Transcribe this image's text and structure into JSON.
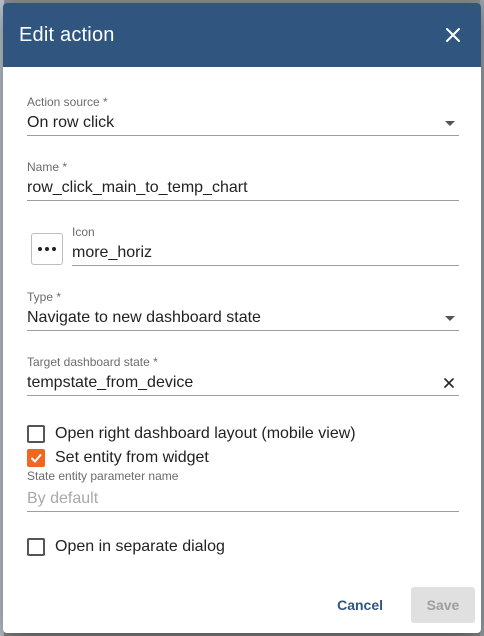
{
  "dialog": {
    "title": "Edit action",
    "close_icon": "close-icon"
  },
  "form": {
    "action_source": {
      "label": "Action source *",
      "value": "On row click"
    },
    "name": {
      "label": "Name *",
      "value": "row_click_main_to_temp_chart"
    },
    "icon": {
      "label": "Icon",
      "value": "more_horiz",
      "button_icon": "more-horiz-icon"
    },
    "type": {
      "label": "Type *",
      "value": "Navigate to new dashboard state"
    },
    "target_state": {
      "label": "Target dashboard state *",
      "value": "tempstate_from_device"
    },
    "open_right_layout": {
      "label": "Open right dashboard layout (mobile view)",
      "checked": false
    },
    "set_entity": {
      "label": "Set entity from widget",
      "checked": true
    },
    "state_entity_param": {
      "label": "State entity parameter name",
      "placeholder": "By default"
    },
    "open_separate_dialog": {
      "label": "Open in separate dialog",
      "checked": false
    }
  },
  "actions": {
    "cancel_label": "Cancel",
    "save_label": "Save"
  },
  "colors": {
    "header": "#305680",
    "accent": "#f26522"
  }
}
